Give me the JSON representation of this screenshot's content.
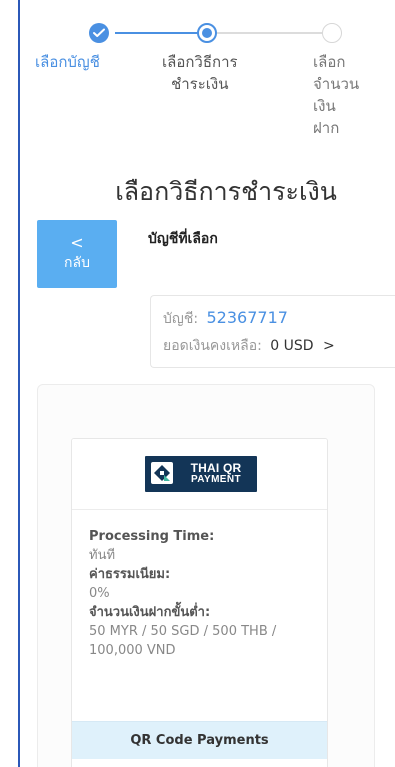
{
  "stepper": {
    "steps": [
      {
        "label": "เลือกบัญชี",
        "status": "completed"
      },
      {
        "label": "เลือกวิธีการ\nชำระเงิน",
        "status": "current"
      },
      {
        "label": "เลือก\nจำนวน\nเงิน\nฝาก",
        "status": "pending"
      }
    ]
  },
  "page": {
    "title": "เลือกวิธีการชำระเงิน"
  },
  "back_button": {
    "chevron": "<",
    "label": "กลับ"
  },
  "selected_account": {
    "heading": "บัญชีที่เลือก",
    "account_label": "บัญชี:",
    "account_number": "52367717",
    "balance_label": "ยอดเงินคงเหลือ:",
    "balance_value": "0 USD",
    "arrow": ">"
  },
  "payment_methods": [
    {
      "logo_line1": "THAI QR",
      "logo_line2": "PAYMENT",
      "processing_time_label": "Processing Time:",
      "processing_time_value": "ทันที",
      "fee_label": "ค่าธรรมเนียม:",
      "fee_value": "0%",
      "min_deposit_label": "จำนวนเงินฝากขั้นต่ำ:",
      "min_deposit_value": "50 MYR / 50 SGD / 500 THB / 100,000 VND",
      "footer": "QR Code Payments"
    }
  ],
  "colors": {
    "accent": "#4A90E2",
    "back_button": "#5AAEF1",
    "logo_bg": "#133557",
    "footer_bg": "#DFF1FB"
  },
  "icons": {
    "completed_step": "check-circle-icon",
    "current_step": "radio-dot-icon",
    "pending_step": "empty-circle-icon",
    "back": "chevron-left-icon",
    "account_arrow": "chevron-right-icon",
    "payment_logo": "thai-qr-logo-icon"
  }
}
